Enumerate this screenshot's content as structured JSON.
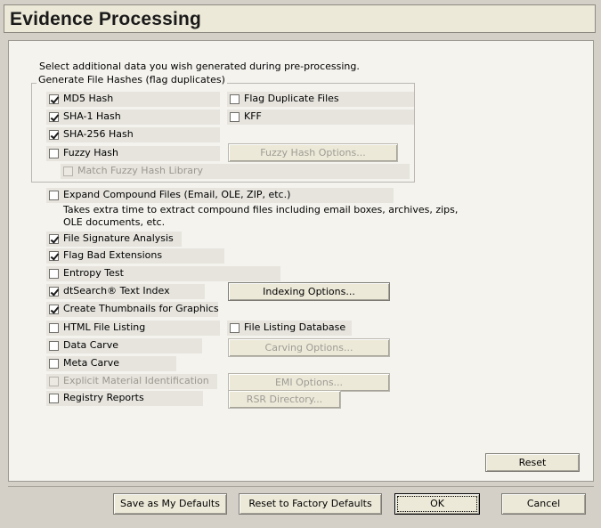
{
  "title": "Evidence Processing",
  "intro": "Select additional data you wish generated during pre-processing.",
  "group_label": "Generate File Hashes (flag duplicates)",
  "hashes": {
    "md5": {
      "label": "MD5 Hash",
      "checked": true
    },
    "flag_duplicate": {
      "label": "Flag Duplicate Files",
      "checked": false
    },
    "sha1": {
      "label": "SHA-1 Hash",
      "checked": true
    },
    "kff": {
      "label": "KFF",
      "checked": false
    },
    "sha256": {
      "label": "SHA-256 Hash",
      "checked": true
    },
    "fuzzy": {
      "label": "Fuzzy Hash",
      "checked": false
    },
    "fuzzy_options": "Fuzzy Hash Options...",
    "match_fuzzy": {
      "label": "Match Fuzzy Hash Library",
      "checked": false,
      "disabled": true
    }
  },
  "options": {
    "expand": {
      "label": "Expand Compound Files (Email, OLE, ZIP, etc.)",
      "checked": false,
      "desc1": "Takes extra time to extract compound files including email boxes, archives, zips,",
      "desc2": "OLE documents, etc."
    },
    "signature": {
      "label": "File Signature Analysis",
      "checked": true
    },
    "bad_ext": {
      "label": "Flag Bad Extensions",
      "checked": true
    },
    "entropy": {
      "label": "Entropy Test",
      "checked": false
    },
    "dtsearch": {
      "label": "dtSearch® Text Index",
      "checked": true
    },
    "indexing_options": "Indexing Options...",
    "thumbnails": {
      "label": "Create Thumbnails for Graphics",
      "checked": true
    },
    "html_listing": {
      "label": "HTML File Listing",
      "checked": false
    },
    "file_listing_db": {
      "label": "File Listing Database",
      "checked": false
    },
    "data_carve": {
      "label": "Data Carve",
      "checked": false
    },
    "carving_options": "Carving Options...",
    "meta_carve": {
      "label": "Meta Carve",
      "checked": false
    },
    "emi": {
      "label": "Explicit Material Identification",
      "checked": false,
      "disabled": true
    },
    "emi_options": "EMI Options...",
    "registry": {
      "label": "Registry Reports",
      "checked": false
    },
    "rsr_directory": "RSR Directory..."
  },
  "buttons": {
    "reset": "Reset",
    "save_defaults": "Save as My Defaults",
    "reset_factory": "Reset to Factory Defaults",
    "ok": "OK",
    "cancel": "Cancel"
  }
}
